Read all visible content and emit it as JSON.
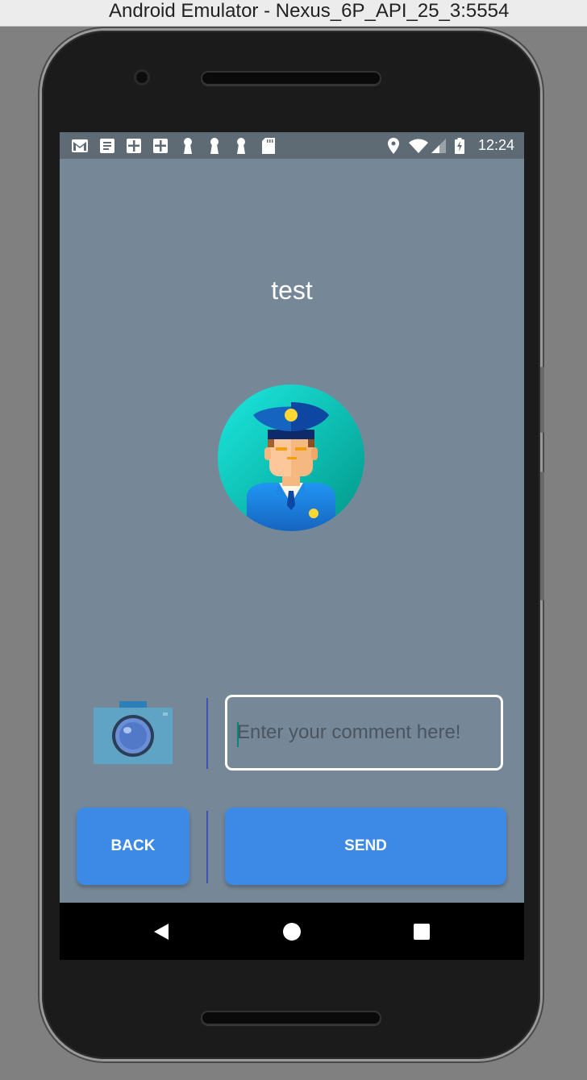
{
  "window": {
    "title": "Android Emulator - Nexus_6P_API_25_3:5554"
  },
  "status_bar": {
    "time": "12:24",
    "left_icons": [
      "gmail-icon",
      "document-icon",
      "plus-square-icon",
      "plus-square-icon",
      "keyhole-icon",
      "keyhole-icon",
      "keyhole-icon",
      "sd-card-icon"
    ],
    "right_icons": [
      "location-icon",
      "wifi-icon",
      "signal-icon",
      "battery-charging-icon"
    ]
  },
  "app": {
    "title": "test",
    "comment": {
      "value": "",
      "placeholder": "Enter your comment here!"
    },
    "back_label": "BACK",
    "send_label": "SEND"
  },
  "colors": {
    "background": "#768797",
    "button": "#3d8ae6",
    "divider": "#3f51b5",
    "accent": "#00897b"
  }
}
